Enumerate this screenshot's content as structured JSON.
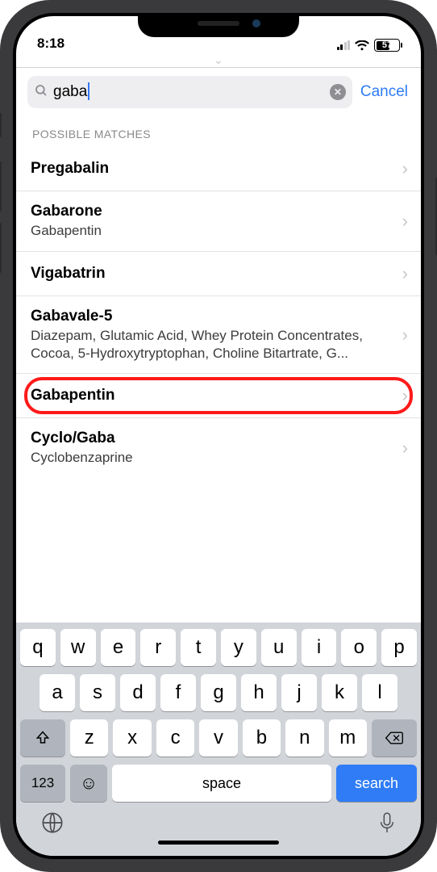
{
  "status": {
    "time": "8:18",
    "battery_pct": "57"
  },
  "search": {
    "value": "gaba",
    "cancel_label": "Cancel"
  },
  "section_header": "POSSIBLE MATCHES",
  "results": [
    {
      "title": "Pregabalin",
      "subtitle": ""
    },
    {
      "title": "Gabarone",
      "subtitle": "Gabapentin"
    },
    {
      "title": "Vigabatrin",
      "subtitle": ""
    },
    {
      "title": "Gabavale-5",
      "subtitle": "Diazepam, Glutamic Acid, Whey Protein Concentrates, Cocoa, 5-Hydroxytryptophan, Choline Bitartrate, G..."
    },
    {
      "title": "Gabapentin",
      "subtitle": "",
      "highlight": true
    },
    {
      "title": "Cyclo/Gaba",
      "subtitle": "Cyclobenzaprine"
    }
  ],
  "keyboard": {
    "row1": [
      "q",
      "w",
      "e",
      "r",
      "t",
      "y",
      "u",
      "i",
      "o",
      "p"
    ],
    "row2": [
      "a",
      "s",
      "d",
      "f",
      "g",
      "h",
      "j",
      "k",
      "l"
    ],
    "row3": [
      "z",
      "x",
      "c",
      "v",
      "b",
      "n",
      "m"
    ],
    "num_label": "123",
    "space_label": "space",
    "search_label": "search"
  }
}
